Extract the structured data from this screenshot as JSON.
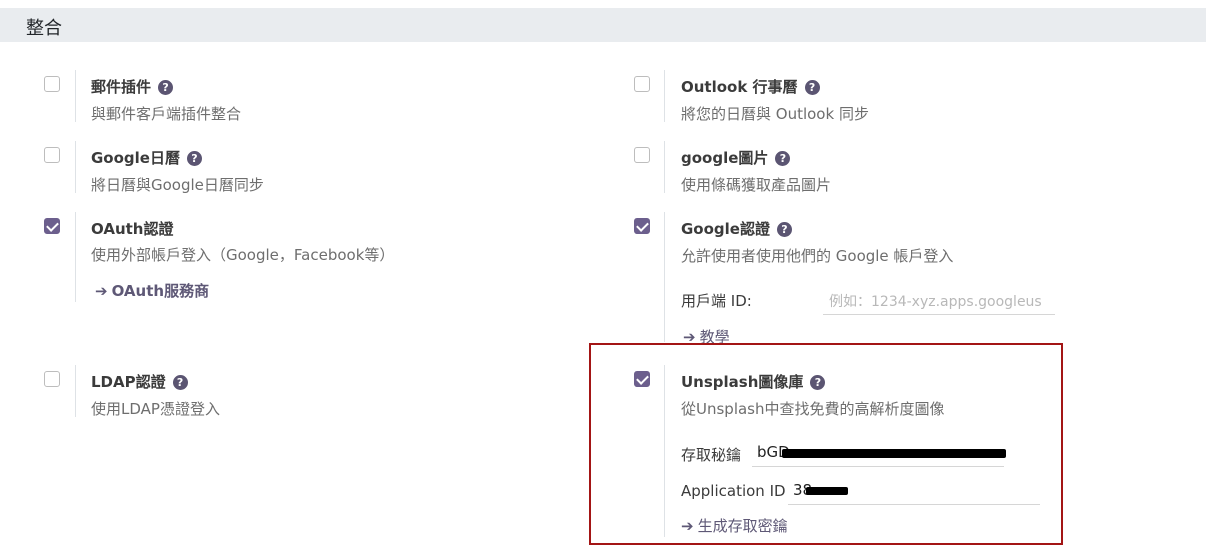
{
  "section": {
    "title": "整合"
  },
  "settings": {
    "mail_plugin": {
      "title": "郵件插件",
      "description": "與郵件客戶端插件整合",
      "checked": false
    },
    "outlook_calendar": {
      "title": "Outlook 行事曆",
      "description": "將您的日曆與 Outlook 同步",
      "checked": false
    },
    "google_calendar": {
      "title": "Google日曆",
      "description": "將日曆與Google日曆同步",
      "checked": false
    },
    "google_images": {
      "title": "google圖片",
      "description": "使用條碼獲取產品圖片",
      "checked": false
    },
    "oauth": {
      "title": "OAuth認證",
      "description": "使用外部帳戶登入（Google，Facebook等）",
      "link": "OAuth服務商",
      "checked": true
    },
    "google_auth": {
      "title": "Google認證",
      "description": "允許使用者使用他們的 Google 帳戶登入",
      "client_id_label": "用戶端 ID:",
      "client_id_placeholder": "例如：1234-xyz.apps.googleus",
      "link": "教學",
      "checked": true
    },
    "ldap": {
      "title": "LDAP認證",
      "description": "使用LDAP憑證登入",
      "checked": false
    },
    "unsplash": {
      "title": "Unsplash圖像庫",
      "description": "從Unsplash中查找免費的高解析度圖像",
      "access_key_label": "存取秘鑰",
      "access_key_value": "bGD",
      "application_id_label": "Application ID",
      "application_id_value": "38",
      "link": "生成存取密鑰",
      "checked": true
    }
  },
  "icons": {
    "help": "question-circle-icon",
    "link_arrow": "arrow-right-icon"
  },
  "colors": {
    "accent": "#6c5f8d",
    "highlight_border": "#a31515",
    "header_bg": "#e9ecef"
  }
}
